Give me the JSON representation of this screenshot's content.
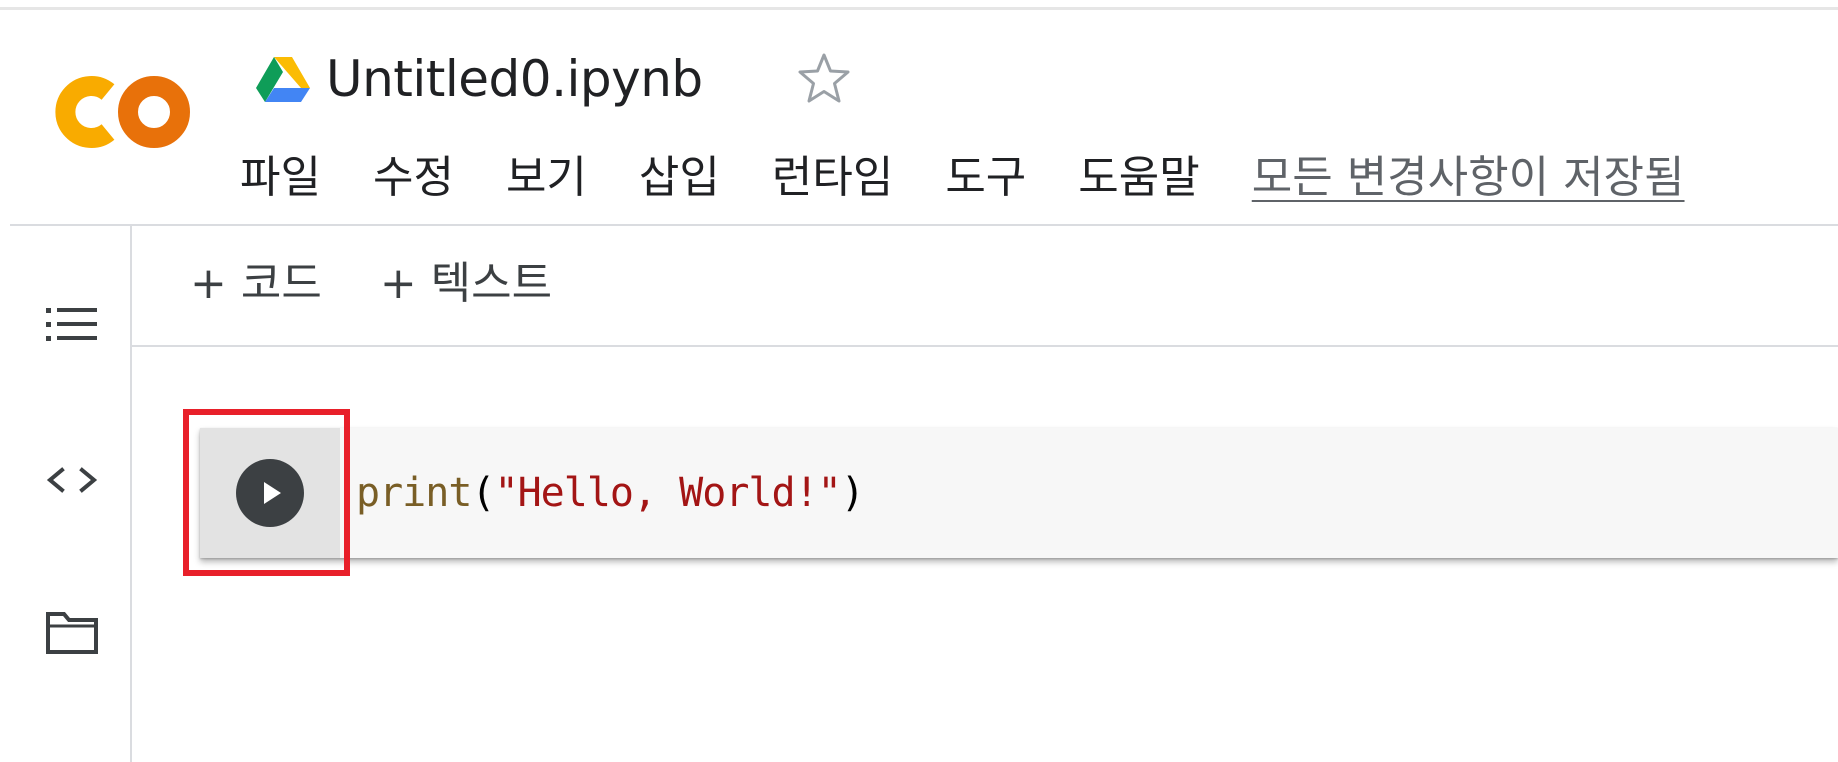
{
  "header": {
    "notebook_title": "Untitled0.ipynb",
    "logo_text": "CO"
  },
  "menu": {
    "items": [
      {
        "label": "파일"
      },
      {
        "label": "수정"
      },
      {
        "label": "보기"
      },
      {
        "label": "삽입"
      },
      {
        "label": "런타임"
      },
      {
        "label": "도구"
      },
      {
        "label": "도움말"
      }
    ],
    "save_status": "모든 변경사항이 저장됨"
  },
  "toolbar": {
    "add_code_label": "+ 코드",
    "add_text_label": "+ 텍스트"
  },
  "sidebar": {
    "icons": [
      "toc-icon",
      "code-snippets-icon",
      "folder-icon"
    ]
  },
  "cell": {
    "code": {
      "fn": "print",
      "open": "(",
      "str": "\"Hello, World!\"",
      "close": ")"
    }
  },
  "colors": {
    "logo_orange": "#f9ab00",
    "logo_dark_orange": "#e8710a",
    "highlight": "#e8202a",
    "string": "#a31515",
    "function": "#795e26"
  }
}
